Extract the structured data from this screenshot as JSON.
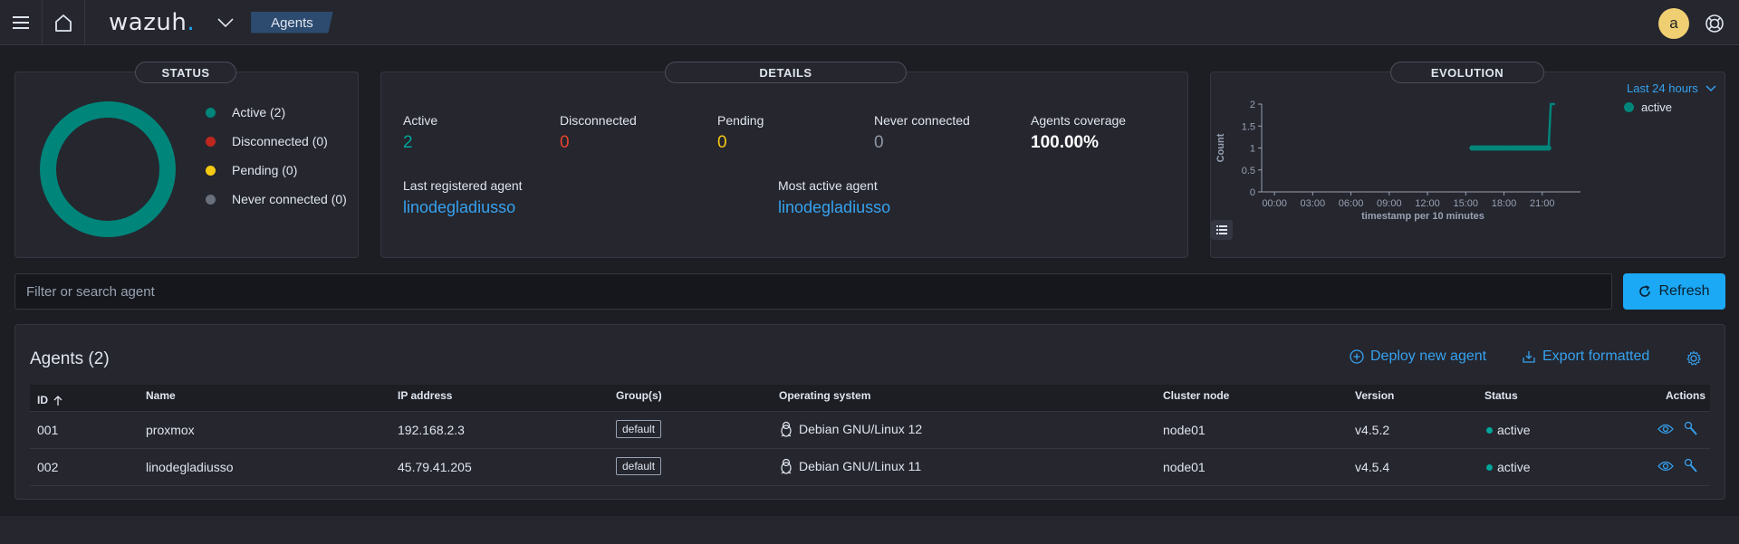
{
  "header": {
    "menu_icon": "hamburger-icon",
    "home_icon": "home-icon",
    "logo_text": "wazuh",
    "logo_dot": ".",
    "breadcrumb": "Agents",
    "avatar_letter": "a",
    "help_icon": "lifebuoy-icon"
  },
  "status": {
    "title": "STATUS",
    "legend": [
      {
        "label": "Active (2)",
        "color": "#00857a"
      },
      {
        "label": "Disconnected (0)",
        "color": "#bd271e"
      },
      {
        "label": "Pending (0)",
        "color": "#f5c913"
      },
      {
        "label": "Never connected (0)",
        "color": "#69707d"
      }
    ]
  },
  "details": {
    "title": "DETAILS",
    "stats": [
      {
        "label": "Active",
        "value": "2",
        "color": "#00a69b"
      },
      {
        "label": "Disconnected",
        "value": "0",
        "color": "#e7432e"
      },
      {
        "label": "Pending",
        "value": "0",
        "color": "#f5c913"
      },
      {
        "label": "Never connected",
        "value": "0",
        "color": "#8f98a5"
      },
      {
        "label": "Agents coverage",
        "value": "100.00%",
        "color": "#ffffff"
      }
    ],
    "last_registered_label": "Last registered agent",
    "last_registered_value": "linodegladiusso",
    "most_active_label": "Most active agent",
    "most_active_value": "linodegladiusso"
  },
  "evolution": {
    "title": "EVOLUTION",
    "range_label": "Last 24 hours",
    "legend_label": "active",
    "list_icon": "list-icon"
  },
  "chart_data": {
    "type": "line",
    "title": "",
    "xlabel": "timestamp per 10 minutes",
    "ylabel": "Count",
    "x_ticks": [
      "00:00",
      "03:00",
      "06:00",
      "09:00",
      "12:00",
      "15:00",
      "18:00",
      "21:00"
    ],
    "y_ticks": [
      "0",
      "0.5",
      "1",
      "1.5",
      "2"
    ],
    "ylim": [
      0,
      2
    ],
    "xlim_hours": [
      -1,
      24
    ],
    "series": [
      {
        "name": "active",
        "color": "#00857a",
        "x_hours": [
          15.5,
          15.67,
          15.83,
          16.0,
          16.17,
          16.33,
          16.5,
          16.67,
          16.83,
          17.0,
          17.17,
          17.33,
          17.5,
          17.67,
          17.83,
          18.0,
          18.17,
          18.33,
          18.5,
          18.67,
          18.83,
          19.0,
          19.17,
          19.33,
          19.5,
          19.67,
          19.83,
          20.0,
          20.17,
          20.33,
          20.5,
          20.67,
          20.83,
          21.0,
          21.17,
          21.33,
          21.5,
          21.67,
          21.83,
          22.0
        ],
        "values": [
          1,
          1,
          1,
          1,
          1,
          1,
          1,
          1,
          1,
          1,
          1,
          1,
          1,
          1,
          1,
          1,
          1,
          1,
          1,
          1,
          1,
          1,
          1,
          1,
          1,
          1,
          1,
          1,
          1,
          1,
          1,
          1,
          1,
          1,
          1,
          1,
          1,
          2,
          2,
          2
        ]
      }
    ],
    "grid": false,
    "legend_position": "top-right"
  },
  "search": {
    "placeholder": "Filter or search agent"
  },
  "refresh": {
    "label": "Refresh",
    "icon": "refresh-icon"
  },
  "agents": {
    "title": "Agents (2)",
    "deploy_label": "Deploy new agent",
    "export_label": "Export formatted",
    "settings_icon": "gear-icon",
    "columns": [
      "ID",
      "Name",
      "IP address",
      "Group(s)",
      "Operating system",
      "Cluster node",
      "Version",
      "Status",
      "Actions"
    ],
    "rows": [
      {
        "id": "001",
        "name": "proxmox",
        "ip": "192.168.2.3",
        "group": "default",
        "os": "Debian GNU/Linux 12",
        "node": "node01",
        "version": "v4.5.2",
        "status": "active"
      },
      {
        "id": "002",
        "name": "linodegladiusso",
        "ip": "45.79.41.205",
        "group": "default",
        "os": "Debian GNU/Linux 11",
        "node": "node01",
        "version": "v4.5.4",
        "status": "active"
      }
    ]
  }
}
